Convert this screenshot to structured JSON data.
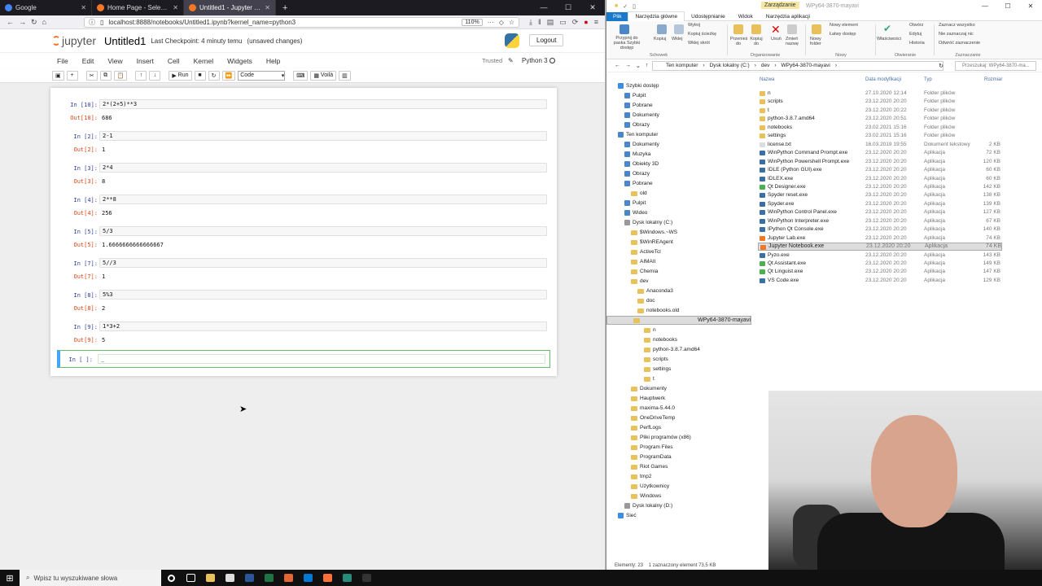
{
  "browser": {
    "tabs": [
      {
        "title": "Google",
        "color": "#4285f4",
        "active": false
      },
      {
        "title": "Home Page - Select or create a notebook",
        "color": "#f37726",
        "active": false
      },
      {
        "title": "Untitled1 - Jupyter Notebook",
        "color": "#f37726",
        "active": true
      }
    ],
    "url": "localhost:8888/notebooks/Untitled1.ipynb?kernel_name=python3",
    "zoom": "110%"
  },
  "jupyter": {
    "logo_text": "jupyter",
    "notebook_name": "Untitled1",
    "checkpoint": "Last Checkpoint: 4 minuty temu",
    "unsaved": "(unsaved changes)",
    "logout_label": "Logout",
    "menu": [
      "File",
      "Edit",
      "View",
      "Insert",
      "Cell",
      "Kernel",
      "Widgets",
      "Help"
    ],
    "trusted": "Trusted",
    "kernel_name": "Python 3",
    "run_label": "Run",
    "cell_type": "Code",
    "voila_label": "Voilà",
    "cells": [
      {
        "in": "In [10]:",
        "code": "2*(2+5)**3",
        "out": "Out[10]:",
        "result": "686"
      },
      {
        "in": "In [2]:",
        "code": "2-1",
        "out": "Out[2]:",
        "result": "1"
      },
      {
        "in": "In [3]:",
        "code": "2*4",
        "out": "Out[3]:",
        "result": "8"
      },
      {
        "in": "In [4]:",
        "code": "2**8",
        "out": "Out[4]:",
        "result": "256"
      },
      {
        "in": "In [5]:",
        "code": "5/3",
        "out": "Out[5]:",
        "result": "1.6666666666666667"
      },
      {
        "in": "In [7]:",
        "code": "5//3",
        "out": "Out[7]:",
        "result": "1"
      },
      {
        "in": "In [8]:",
        "code": "5%3",
        "out": "Out[8]:",
        "result": "2"
      },
      {
        "in": "In [9]:",
        "code": "1*3+2",
        "out": "Out[9]:",
        "result": "5"
      }
    ],
    "active_prompt": "In [ ]:",
    "active_code": "_"
  },
  "explorer": {
    "title_context": "Zarządzanie",
    "title": "WPy64-3870-mayavi",
    "ribbon_tabs": [
      "Plik",
      "Narzędzia główne",
      "Udostępnianie",
      "Widok",
      "Narzędzia aplikacji"
    ],
    "ribbon": {
      "pin": "Przypnij do paska Szybki dostęp",
      "copy": "Kopiuj",
      "paste": "Wklej",
      "cut": "Wytnij",
      "copy_path": "Kopiuj ścieżkę",
      "paste_shortcut": "Wklej skrót",
      "group_clipboard": "Schowek",
      "move_to": "Przenieś do",
      "copy_to": "Kopiuj do",
      "delete": "Usuń",
      "rename": "Zmień nazwę",
      "group_organize": "Organizowanie",
      "new_folder": "Nowy folder",
      "new_item": "Nowy element",
      "easy_access": "Łatwy dostęp",
      "group_new": "Nowy",
      "properties": "Właściwości",
      "open": "Otwórz",
      "edit": "Edytuj",
      "history": "Historia",
      "group_open": "Otwieranie",
      "select_all": "Zaznacz wszystko",
      "select_none": "Nie zaznaczaj nic",
      "invert": "Odwróć zaznaczenie",
      "group_select": "Zaznaczanie"
    },
    "breadcrumb": [
      "Ten komputer",
      "Dysk lokalny (C:)",
      "dev",
      "WPy64-3870-mayavi"
    ],
    "search_placeholder": "Przeszukaj: WPy64-3870-ma...",
    "columns": [
      "Nazwa",
      "Data modyfikacji",
      "Typ",
      "Rozmiar"
    ],
    "nav": [
      {
        "label": "Szybki dostęp",
        "indent": 0,
        "type": "star"
      },
      {
        "label": "Pulpit",
        "indent": 1,
        "type": "blue"
      },
      {
        "label": "Pobrane",
        "indent": 1,
        "type": "blue"
      },
      {
        "label": "Dokumenty",
        "indent": 1,
        "type": "blue"
      },
      {
        "label": "Obrazy",
        "indent": 1,
        "type": "blue"
      },
      {
        "label": "Ten komputer",
        "indent": 0,
        "type": "pc"
      },
      {
        "label": "Dokumenty",
        "indent": 1,
        "type": "blue"
      },
      {
        "label": "Muzyka",
        "indent": 1,
        "type": "blue"
      },
      {
        "label": "Obiekty 3D",
        "indent": 1,
        "type": "blue"
      },
      {
        "label": "Obrazy",
        "indent": 1,
        "type": "blue"
      },
      {
        "label": "Pobrane",
        "indent": 1,
        "type": "blue"
      },
      {
        "label": "old",
        "indent": 2,
        "type": "folder"
      },
      {
        "label": "Pulpit",
        "indent": 1,
        "type": "blue"
      },
      {
        "label": "Wideo",
        "indent": 1,
        "type": "blue"
      },
      {
        "label": "Dysk lokalny (C:)",
        "indent": 1,
        "type": "drive"
      },
      {
        "label": "$Windows.~WS",
        "indent": 2,
        "type": "folder"
      },
      {
        "label": "$WinREAgent",
        "indent": 2,
        "type": "folder"
      },
      {
        "label": "ActiveTcl",
        "indent": 2,
        "type": "folder"
      },
      {
        "label": "AIMAII",
        "indent": 2,
        "type": "folder"
      },
      {
        "label": "Chemia",
        "indent": 2,
        "type": "folder"
      },
      {
        "label": "dev",
        "indent": 2,
        "type": "folder"
      },
      {
        "label": "Anaconda3",
        "indent": 3,
        "type": "folder"
      },
      {
        "label": "doc",
        "indent": 3,
        "type": "folder"
      },
      {
        "label": "notebooks.old",
        "indent": 3,
        "type": "folder"
      },
      {
        "label": "WPy64-3870-mayavi",
        "indent": 3,
        "type": "folder",
        "selected": true
      },
      {
        "label": "n",
        "indent": 4,
        "type": "folder"
      },
      {
        "label": "notebooks",
        "indent": 4,
        "type": "folder"
      },
      {
        "label": "python-3.8.7.amd64",
        "indent": 4,
        "type": "folder"
      },
      {
        "label": "scripts",
        "indent": 4,
        "type": "folder"
      },
      {
        "label": "settings",
        "indent": 4,
        "type": "folder"
      },
      {
        "label": "t",
        "indent": 4,
        "type": "folder"
      },
      {
        "label": "Dokumenty",
        "indent": 2,
        "type": "folder"
      },
      {
        "label": "Hauptwerk",
        "indent": 2,
        "type": "folder"
      },
      {
        "label": "maxima-5.44.0",
        "indent": 2,
        "type": "folder"
      },
      {
        "label": "OneDriveTemp",
        "indent": 2,
        "type": "folder"
      },
      {
        "label": "PerfLogs",
        "indent": 2,
        "type": "folder"
      },
      {
        "label": "Pliki programów (x86)",
        "indent": 2,
        "type": "folder"
      },
      {
        "label": "Program Files",
        "indent": 2,
        "type": "folder"
      },
      {
        "label": "ProgramData",
        "indent": 2,
        "type": "folder"
      },
      {
        "label": "Riot Games",
        "indent": 2,
        "type": "folder"
      },
      {
        "label": "tmp2",
        "indent": 2,
        "type": "folder"
      },
      {
        "label": "Użytkownicy",
        "indent": 2,
        "type": "folder"
      },
      {
        "label": "Windows",
        "indent": 2,
        "type": "folder"
      },
      {
        "label": "Dysk lokalny (D:)",
        "indent": 1,
        "type": "drive"
      },
      {
        "label": "Sieć",
        "indent": 0,
        "type": "net"
      }
    ],
    "files": [
      {
        "name": "n",
        "date": "27.10.2020 12:14",
        "type": "Folder plików",
        "size": "",
        "icon": "folder"
      },
      {
        "name": "scripts",
        "date": "23.12.2020 20:20",
        "type": "Folder plików",
        "size": "",
        "icon": "folder"
      },
      {
        "name": "t",
        "date": "23.12.2020 20:22",
        "type": "Folder plików",
        "size": "",
        "icon": "folder"
      },
      {
        "name": "python-3.8.7.amd64",
        "date": "23.12.2020 20:51",
        "type": "Folder plików",
        "size": "",
        "icon": "folder"
      },
      {
        "name": "notebooks",
        "date": "23.02.2021 15:16",
        "type": "Folder plików",
        "size": "",
        "icon": "folder"
      },
      {
        "name": "settings",
        "date": "23.02.2021 15:16",
        "type": "Folder plików",
        "size": "",
        "icon": "folder"
      },
      {
        "name": "license.txt",
        "date": "16.03.2019 19:55",
        "type": "Dokument tekstowy",
        "size": "2 KB",
        "icon": "text"
      },
      {
        "name": "WinPython Command Prompt.exe",
        "date": "23.12.2020 20:20",
        "type": "Aplikacja",
        "size": "72 KB",
        "icon": "app"
      },
      {
        "name": "WinPython Powershell Prompt.exe",
        "date": "23.12.2020 20:20",
        "type": "Aplikacja",
        "size": "120 KB",
        "icon": "app"
      },
      {
        "name": "IDLE (Python GUI).exe",
        "date": "23.12.2020 20:20",
        "type": "Aplikacja",
        "size": "60 KB",
        "icon": "app"
      },
      {
        "name": "IDLEX.exe",
        "date": "23.12.2020 20:20",
        "type": "Aplikacja",
        "size": "60 KB",
        "icon": "app"
      },
      {
        "name": "Qt Designer.exe",
        "date": "23.12.2020 20:20",
        "type": "Aplikacja",
        "size": "142 KB",
        "icon": "green"
      },
      {
        "name": "Spyder reset.exe",
        "date": "23.12.2020 20:20",
        "type": "Aplikacja",
        "size": "138 KB",
        "icon": "app"
      },
      {
        "name": "Spyder.exe",
        "date": "23.12.2020 20:20",
        "type": "Aplikacja",
        "size": "139 KB",
        "icon": "app"
      },
      {
        "name": "WinPython Control Panel.exe",
        "date": "23.12.2020 20:20",
        "type": "Aplikacja",
        "size": "127 KB",
        "icon": "app"
      },
      {
        "name": "WinPython Interpreter.exe",
        "date": "23.12.2020 20:20",
        "type": "Aplikacja",
        "size": "67 KB",
        "icon": "app"
      },
      {
        "name": "IPython Qt Console.exe",
        "date": "23.12.2020 20:20",
        "type": "Aplikacja",
        "size": "140 KB",
        "icon": "app"
      },
      {
        "name": "Jupyter Lab.exe",
        "date": "23.12.2020 20:20",
        "type": "Aplikacja",
        "size": "74 KB",
        "icon": "orange"
      },
      {
        "name": "Jupyter Notebook.exe",
        "date": "23.12.2020 20:20",
        "type": "Aplikacja",
        "size": "74 KB",
        "icon": "orange",
        "selected": true
      },
      {
        "name": "Pyzo.exe",
        "date": "23.12.2020 20:20",
        "type": "Aplikacja",
        "size": "143 KB",
        "icon": "app"
      },
      {
        "name": "Qt Assistant.exe",
        "date": "23.12.2020 20:20",
        "type": "Aplikacja",
        "size": "149 KB",
        "icon": "green"
      },
      {
        "name": "Qt Linguist.exe",
        "date": "23.12.2020 20:20",
        "type": "Aplikacja",
        "size": "147 KB",
        "icon": "green"
      },
      {
        "name": "VS Code.exe",
        "date": "23.12.2020 20:20",
        "type": "Aplikacja",
        "size": "129 KB",
        "icon": "app"
      }
    ],
    "status_count": "Elementy: 23",
    "status_selected": "1 zaznaczony element  73,5 KB"
  },
  "taskbar": {
    "search_placeholder": "Wpisz tu wyszukiwane słowa",
    "apps": [
      "cortana",
      "task-view",
      "files",
      "store",
      "word",
      "excel",
      "matlab",
      "mail",
      "firefox",
      "jupyter",
      "terminal"
    ]
  }
}
